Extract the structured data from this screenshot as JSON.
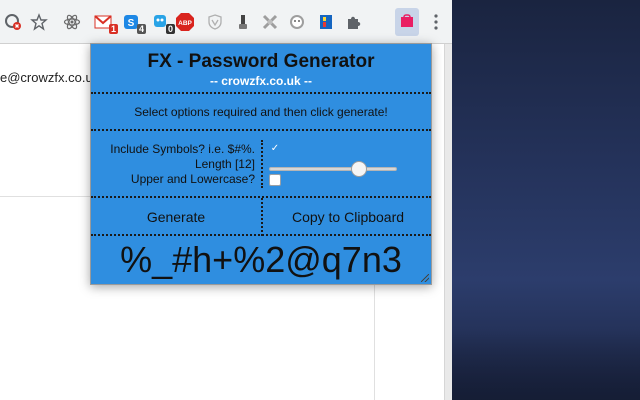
{
  "browser": {
    "page_email_fragment": "e@crowzfx.co.uk",
    "toolbar_icons": [
      {
        "name": "blocked-cookie-icon"
      },
      {
        "name": "bookmark-star-icon"
      },
      {
        "name": "react-devtools-icon"
      },
      {
        "name": "gmail-icon",
        "badge": "1",
        "badge_color": "#d93025"
      },
      {
        "name": "skype-icon",
        "badge": "4",
        "badge_color": "#555555"
      },
      {
        "name": "extension-blue-icon",
        "badge": "0",
        "badge_color": "#333333"
      },
      {
        "name": "adblock-plus-icon",
        "label": "ABP"
      },
      {
        "name": "vpn-shield-icon"
      },
      {
        "name": "paint-bucket-icon"
      },
      {
        "name": "puzzle-cross-icon"
      },
      {
        "name": "face-icon"
      },
      {
        "name": "colorful-bar-icon"
      },
      {
        "name": "extensions-puzzle-icon"
      },
      {
        "name": "fx-password-generator-icon"
      },
      {
        "name": "chrome-menu-icon"
      }
    ]
  },
  "popup": {
    "title": "FX - Password Generator",
    "subtitle": "-- crowzfx.co.uk --",
    "instruction": "Select options required and then click generate!",
    "options": {
      "symbols_label": "Include Symbols? i.e. $#%.",
      "symbols_checked": true,
      "length_label": "Length [12]",
      "length_value": 12,
      "length_fraction": 0.73,
      "case_label": "Upper and Lowercase?",
      "case_checked": false
    },
    "generate_label": "Generate",
    "copy_label": "Copy to Clipboard",
    "password": "%_#h+%2@q7n3",
    "accent_color": "#2f8ee0"
  }
}
